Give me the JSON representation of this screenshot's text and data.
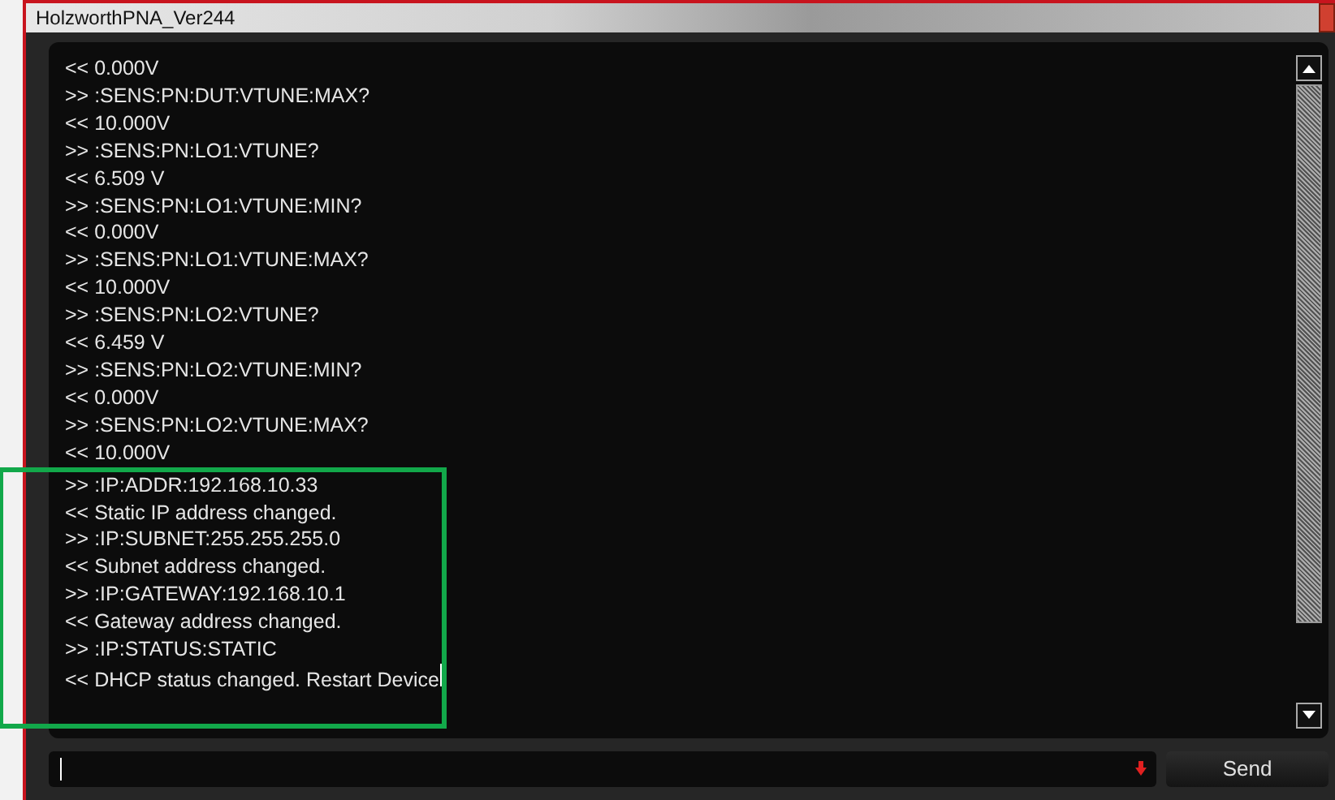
{
  "window": {
    "title": "HolzworthPNA_Ver244"
  },
  "console": {
    "lines": [
      "<< 0.000V",
      ">> :SENS:PN:DUT:VTUNE:MAX?",
      "<< 10.000V",
      ">> :SENS:PN:LO1:VTUNE?",
      "<< 6.509 V",
      ">> :SENS:PN:LO1:VTUNE:MIN?",
      "<< 0.000V",
      ">> :SENS:PN:LO1:VTUNE:MAX?",
      "<< 10.000V",
      ">> :SENS:PN:LO2:VTUNE?",
      "<< 6.459 V",
      ">> :SENS:PN:LO2:VTUNE:MIN?",
      "<< 0.000V",
      ">> :SENS:PN:LO2:VTUNE:MAX?",
      "<< 10.000V"
    ],
    "highlighted_lines": [
      ">> :IP:ADDR:192.168.10.33",
      "<< Static IP address changed.",
      ">> :IP:SUBNET:255.255.255.0",
      "<< Subnet address changed.",
      ">> :IP:GATEWAY:192.168.10.1",
      "<< Gateway address changed.",
      ">> :IP:STATUS:STATIC",
      "<< DHCP status changed. Restart Device"
    ]
  },
  "send_button": {
    "label": "Send"
  }
}
